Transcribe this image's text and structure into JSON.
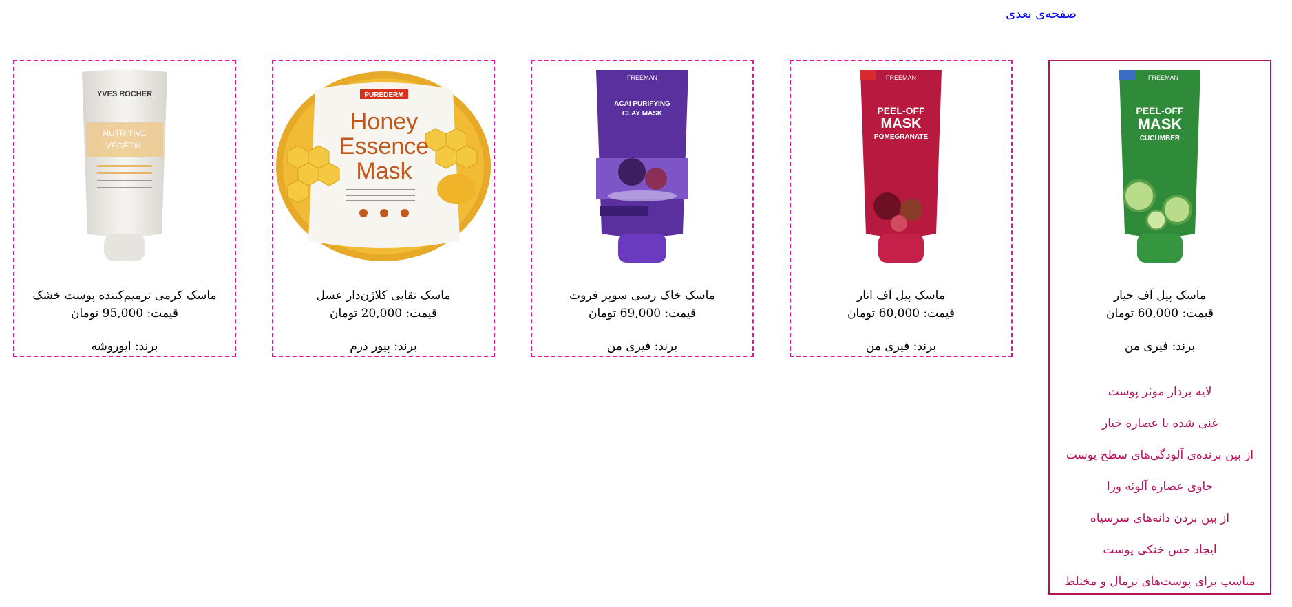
{
  "nav": {
    "next_page": "صفحه‌ی بعدی"
  },
  "products": [
    {
      "name": "ماسک کرمی ترمیم‌کننده پوست خشک",
      "price": "قیمت: 95,000 تومان",
      "brand": "برند: ایوروشه",
      "image_icon": "yves-rocher-tube-icon",
      "packaging_text": {
        "line1": "YVES ROCHER",
        "line2": "NUTRITIVE",
        "line3": "VÉGÉTAL"
      }
    },
    {
      "name": "ماسک نقابی کلاژن‌دار عسل",
      "price": "قیمت: 20,000 تومان",
      "brand": "برند: پیور درم",
      "image_icon": "honey-sheet-mask-icon",
      "packaging_text": {
        "line1": "PUREDERM",
        "line2": "Honey",
        "line3": "Essence",
        "line4": "Mask"
      }
    },
    {
      "name": "ماسک خاک رسی سوپر فروت",
      "price": "قیمت: 69,000 تومان",
      "brand": "برند: فیری من",
      "image_icon": "purple-clay-mask-tube-icon",
      "packaging_text": {
        "line1": "FREEMAN",
        "line2": "ACAI PURIFYING",
        "line3": "CLAY MASK"
      }
    },
    {
      "name": "ماسک پیل آف انار",
      "price": "قیمت: 60,000 تومان",
      "brand": "برند: فیری من",
      "image_icon": "pomegranate-peel-off-tube-icon",
      "packaging_text": {
        "line1": "FREEMAN",
        "line2": "PEEL-OFF",
        "line3": "MASK",
        "line4": "POMEGRANATE"
      }
    },
    {
      "name": "ماسک پیل آف خیار",
      "price": "قیمت: 60,000 تومان",
      "brand": "برند: فیری من",
      "image_icon": "cucumber-peel-off-tube-icon",
      "packaging_text": {
        "line1": "FREEMAN",
        "line2": "PEEL-OFF",
        "line3": "MASK",
        "line4": "CUCUMBER"
      },
      "features": [
        "لایه بردار موثر پوست",
        "غنی شده با عصاره خیار",
        "از بین برنده‌ی آلودگی‌های سطح پوست",
        "حاوی عصاره آلوئه ورا",
        "از بین بردن دانه‌های سرسیاه",
        "ایجاد حس خنکی پوست",
        "مناسب برای پوست‌های نرمال و مختلط"
      ]
    }
  ],
  "colors": {
    "card_border_dashed": "#ee1199",
    "card_border_active": "#b5125a",
    "feature_text": "#b5125a",
    "link": "#0000ee"
  }
}
